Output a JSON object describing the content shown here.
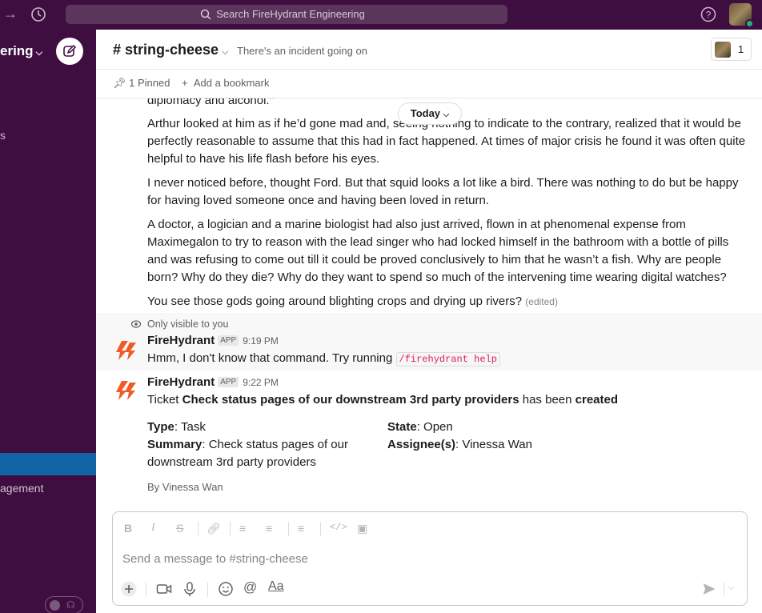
{
  "search": {
    "placeholder": "Search FireHydrant Engineering"
  },
  "sidebar": {
    "workspace_name": "ering",
    "stub_text": "s",
    "item_label": "agement"
  },
  "channel": {
    "name": "# string-cheese",
    "topic": "There's an incident going on",
    "member_count": "1"
  },
  "bookmarks": {
    "pinned": "1 Pinned",
    "add": "Add a bookmark"
  },
  "messages": {
    "date_divider": "Today",
    "paragraphs": [
      "diplomacy and alcohol.”",
      "Arthur looked at him as if he’d gone mad and, seeing nothing to indicate to the contrary, realized that it would be perfectly reasonable to assume that this had in fact happened. At times of major crisis he found it was often quite helpful to have his life flash before his eyes.",
      "I never noticed before, thought Ford. But that squid looks a lot like a bird. There was nothing to do but be happy for having loved someone once and having been loved in return.",
      "A doctor, a logician and a marine biologist had also just arrived, flown in at phenomenal expense from Maximegalon to try to reason with the lead singer who had locked himself in the bathroom with a bottle of pills and was refusing to come out till it could be proved conclusively to him that he wasn’t a fish. Why are people born? Why do they die? Why do they want to spend so much of the intervening time wearing digital watches?",
      "You see those gods going around blighting crops and drying up rivers?"
    ],
    "edited_label": "(edited)",
    "ephemeral": {
      "note": "Only visible to you",
      "sender": "FireHydrant",
      "badge": "APP",
      "time": "9:19 PM",
      "text": "Hmm, I don't know that command. Try running",
      "command": "/firehydrant help"
    },
    "ticket": {
      "sender": "FireHydrant",
      "badge": "APP",
      "time": "9:22 PM",
      "prefix": "Ticket",
      "title": "Check status pages of our downstream 3rd party providers",
      "middle": "has been",
      "status_word": "created",
      "type_label": "Type",
      "type_value": ": Task",
      "summary_label": "Summary",
      "summary_value": ": Check status pages of our",
      "summary_value_2": "downstream 3rd party providers",
      "state_label": "State",
      "state_value": ": Open",
      "assignee_label": "Assignee(s)",
      "assignee_value": ": Vinessa Wan",
      "byline": "By Vinessa Wan"
    }
  },
  "composer": {
    "placeholder": "Send a message to #string-cheese"
  },
  "colors": {
    "aubergine": "#3f0e40",
    "active_blue": "#1164a3",
    "firehydrant_orange": "#f15a24"
  }
}
